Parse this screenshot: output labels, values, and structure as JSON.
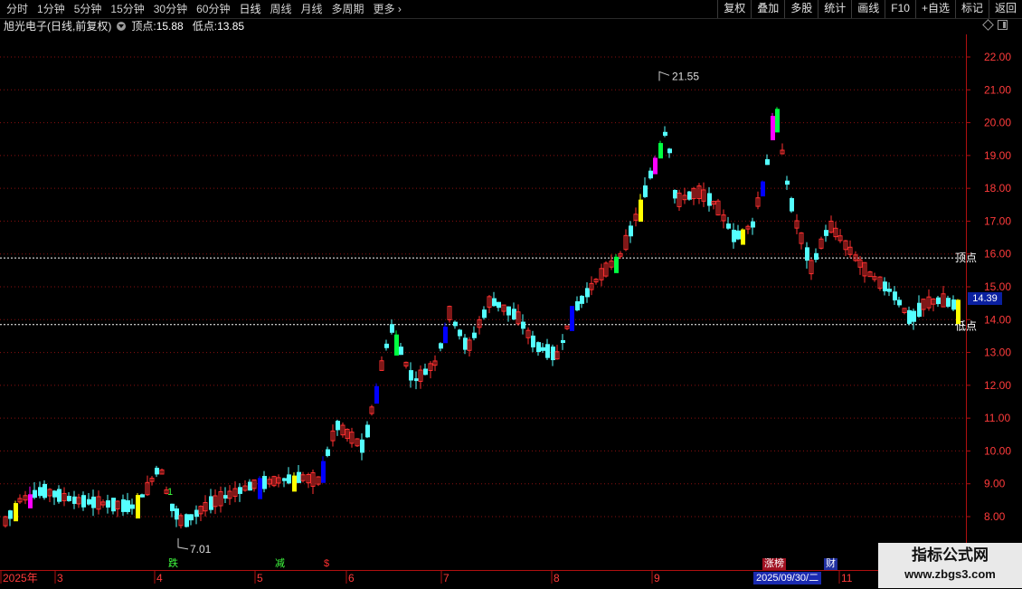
{
  "toolbar": {
    "tabs": [
      "分时",
      "1分钟",
      "5分钟",
      "15分钟",
      "30分钟",
      "60分钟",
      "日线",
      "周线",
      "月线",
      "多周期",
      "更多"
    ],
    "tools": [
      "复权",
      "叠加",
      "多股",
      "统计",
      "画线",
      "F10",
      "+自选",
      "标记",
      "返回"
    ]
  },
  "info": {
    "stock_name": "旭光电子",
    "period": "(日线,前复权)",
    "top_label": "顶点:",
    "top_value": "15.88",
    "low_label": "低点:",
    "low_value": "13.85"
  },
  "price_axis": {
    "ticks": [
      "22.00",
      "21.00",
      "20.00",
      "19.00",
      "18.00",
      "17.00",
      "16.00",
      "15.00",
      "14.00",
      "13.00",
      "12.00",
      "11.00",
      "10.00",
      "9.00",
      "8.00"
    ],
    "current_price": "14.39",
    "top_line_label": "顶点",
    "low_line_label": "低点"
  },
  "chart_annotations": {
    "high_label": "21.55",
    "low_label": "7.01",
    "small_mark": "1"
  },
  "date_axis": {
    "labels": [
      "2025年",
      "3",
      "4",
      "5",
      "6",
      "7",
      "8",
      "9",
      "11"
    ],
    "selected_date": "2025/09/30/二"
  },
  "signals": [
    "跌",
    "减",
    "$",
    "涨榜",
    "财"
  ],
  "colors": {
    "up_candle": "#ff3030",
    "down_candle": "#54ffff",
    "grid": "#8a1010",
    "level_line": "#ffffff",
    "highlight_yellow": "#ffff00",
    "highlight_magenta": "#ff00ff",
    "highlight_green": "#00ff40",
    "highlight_blue": "#0000ff"
  },
  "watermark": {
    "title": "指标公式网",
    "url": "www.zbgs3.com"
  },
  "chart_data": {
    "type": "candlestick",
    "ylim": [
      7.5,
      22.5
    ],
    "levels": {
      "top": 15.88,
      "low": 13.85
    },
    "high_point": 21.55,
    "low_point": 7.01,
    "current": 14.39
  }
}
